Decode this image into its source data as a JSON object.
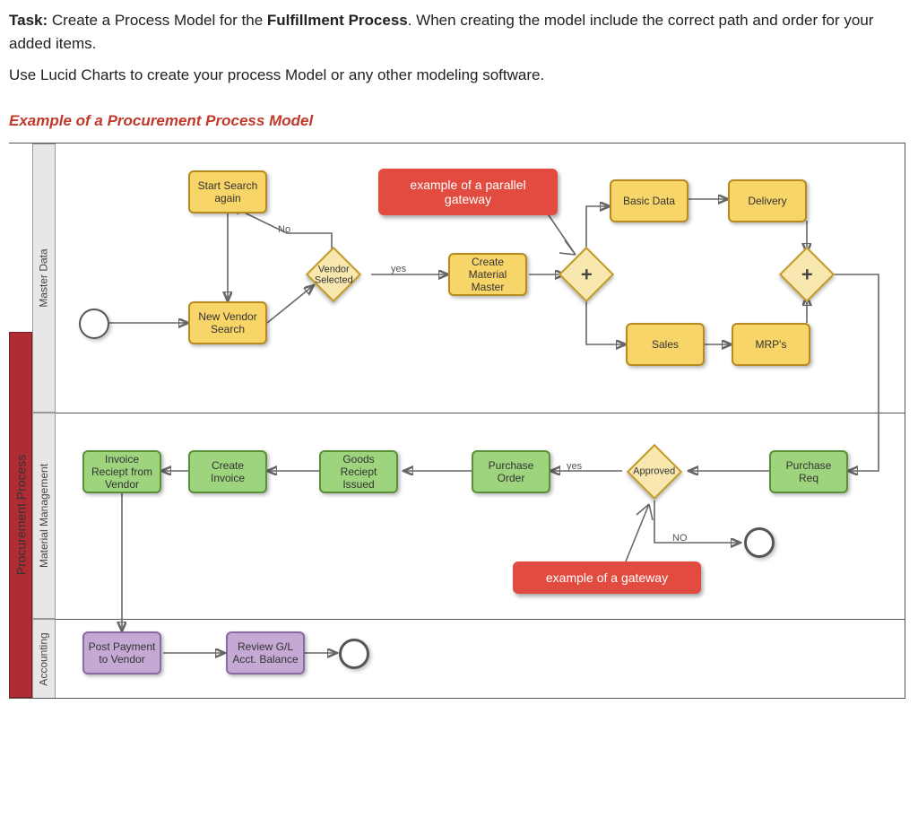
{
  "task": {
    "label": "Task:",
    "line1a": "Create a Process Model for the ",
    "line1b": "Fulfillment Process",
    "line1c": ".  When creating the model include the correct path and order for your added items.",
    "line2": "Use Lucid Charts to create your process Model or any other modeling software."
  },
  "example_heading": "Example of a Procurement Process Model",
  "pool": {
    "title": "Procurement Process"
  },
  "lanes": {
    "l1": "Master Data",
    "l2": "Material Management",
    "l3": "Accounting"
  },
  "nodes": {
    "start_search_again": "Start Search again",
    "new_vendor_search": "New Vendor Search",
    "vendor_selected": "Vendor Selected",
    "create_material_master": "Create Material Master",
    "basic_data": "Basic Data",
    "delivery": "Delivery",
    "sales": "Sales",
    "mrps": "MRP's",
    "invoice_receipt": "Invoice Reciept from Vendor",
    "create_invoice": "Create Invoice",
    "goods_receipt": "Goods Reciept Issued",
    "purchase_order": "Purchase Order",
    "approved": "Approved",
    "purchase_req": "Purchase Req",
    "post_payment": "Post Payment to Vendor",
    "review_gl": "Review G/L Acct. Balance",
    "plus": "+"
  },
  "callouts": {
    "parallel": "example of a parallel gateway",
    "gateway": "example of a gateway"
  },
  "edge_labels": {
    "no1": "No",
    "yes1": "yes",
    "yes2": "yes",
    "no2": "NO"
  }
}
